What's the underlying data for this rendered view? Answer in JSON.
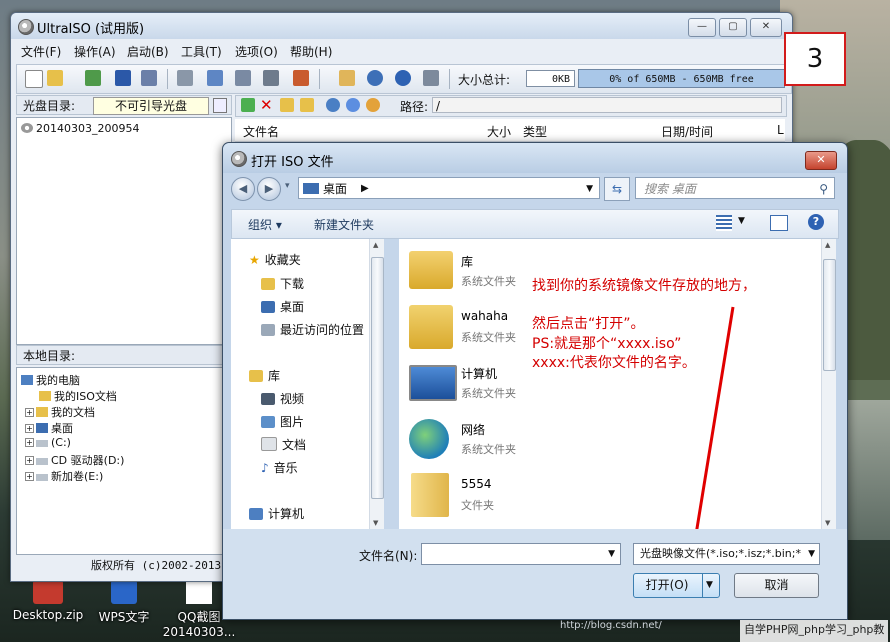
{
  "main_window": {
    "title": "UltraISO (试用版)",
    "menu": [
      "文件(F)",
      "操作(A)",
      "启动(B)",
      "工具(T)",
      "选项(O)",
      "帮助(H)"
    ],
    "size_label": "大小总计:",
    "size_value": "0KB",
    "capacity_text": "0% of 650MB - 650MB free",
    "disc_label": "光盘目录:",
    "disc_value": "不可引导光盘",
    "path_label": "路径:",
    "path_value": "/",
    "iso_item": "20140303_200954",
    "columns": {
      "name": "文件名",
      "size": "大小",
      "type": "类型",
      "date": "日期/时间",
      "l": "L"
    },
    "local_dir": "本地目录:",
    "tree": [
      "我的电脑",
      "我的ISO文档",
      "我的文档",
      "桌面",
      "(C:)",
      "CD 驱动器(D:)",
      "新加卷(E:)"
    ],
    "copyright": "版权所有 (c)2002-2013"
  },
  "step_number": "3",
  "dialog": {
    "title": "打开 ISO 文件",
    "address": "桌面",
    "search_placeholder": "搜索 桌面",
    "organize": "组织 ▾",
    "new_folder": "新建文件夹",
    "nav": {
      "favorites": "收藏夹",
      "downloads": "下载",
      "desktop": "桌面",
      "recent": "最近访问的位置",
      "libraries": "库",
      "videos": "视频",
      "pictures": "图片",
      "documents": "文档",
      "music": "音乐",
      "computer": "计算机"
    },
    "files": [
      {
        "name": "库",
        "sub": "系统文件夹"
      },
      {
        "name": "wahaha",
        "sub": "系统文件夹"
      },
      {
        "name": "计算机",
        "sub": "系统文件夹"
      },
      {
        "name": "网络",
        "sub": "系统文件夹"
      },
      {
        "name": "5554",
        "sub": "文件夹"
      }
    ],
    "annotation": {
      "line1": "找到你的系统镜像文件存放的地方，",
      "line2": "然后点击“打开”。",
      "line3": "PS:就是那个“xxxx.iso”",
      "line4": "xxxx:代表你文件的名字。"
    },
    "filename_label": "文件名(N):",
    "filename_value": "",
    "filter": "光盘映像文件(*.iso;*.isz;*.bin;*",
    "open_button": "打开(O)",
    "cancel_button": "取消"
  },
  "desktop_icons": [
    "Desktop.zip",
    "WPS文字",
    "QQ截图20140303..."
  ],
  "watermark": "自学PHP网_php学习_php教",
  "watermark_url": "http://blog.csdn.net/"
}
